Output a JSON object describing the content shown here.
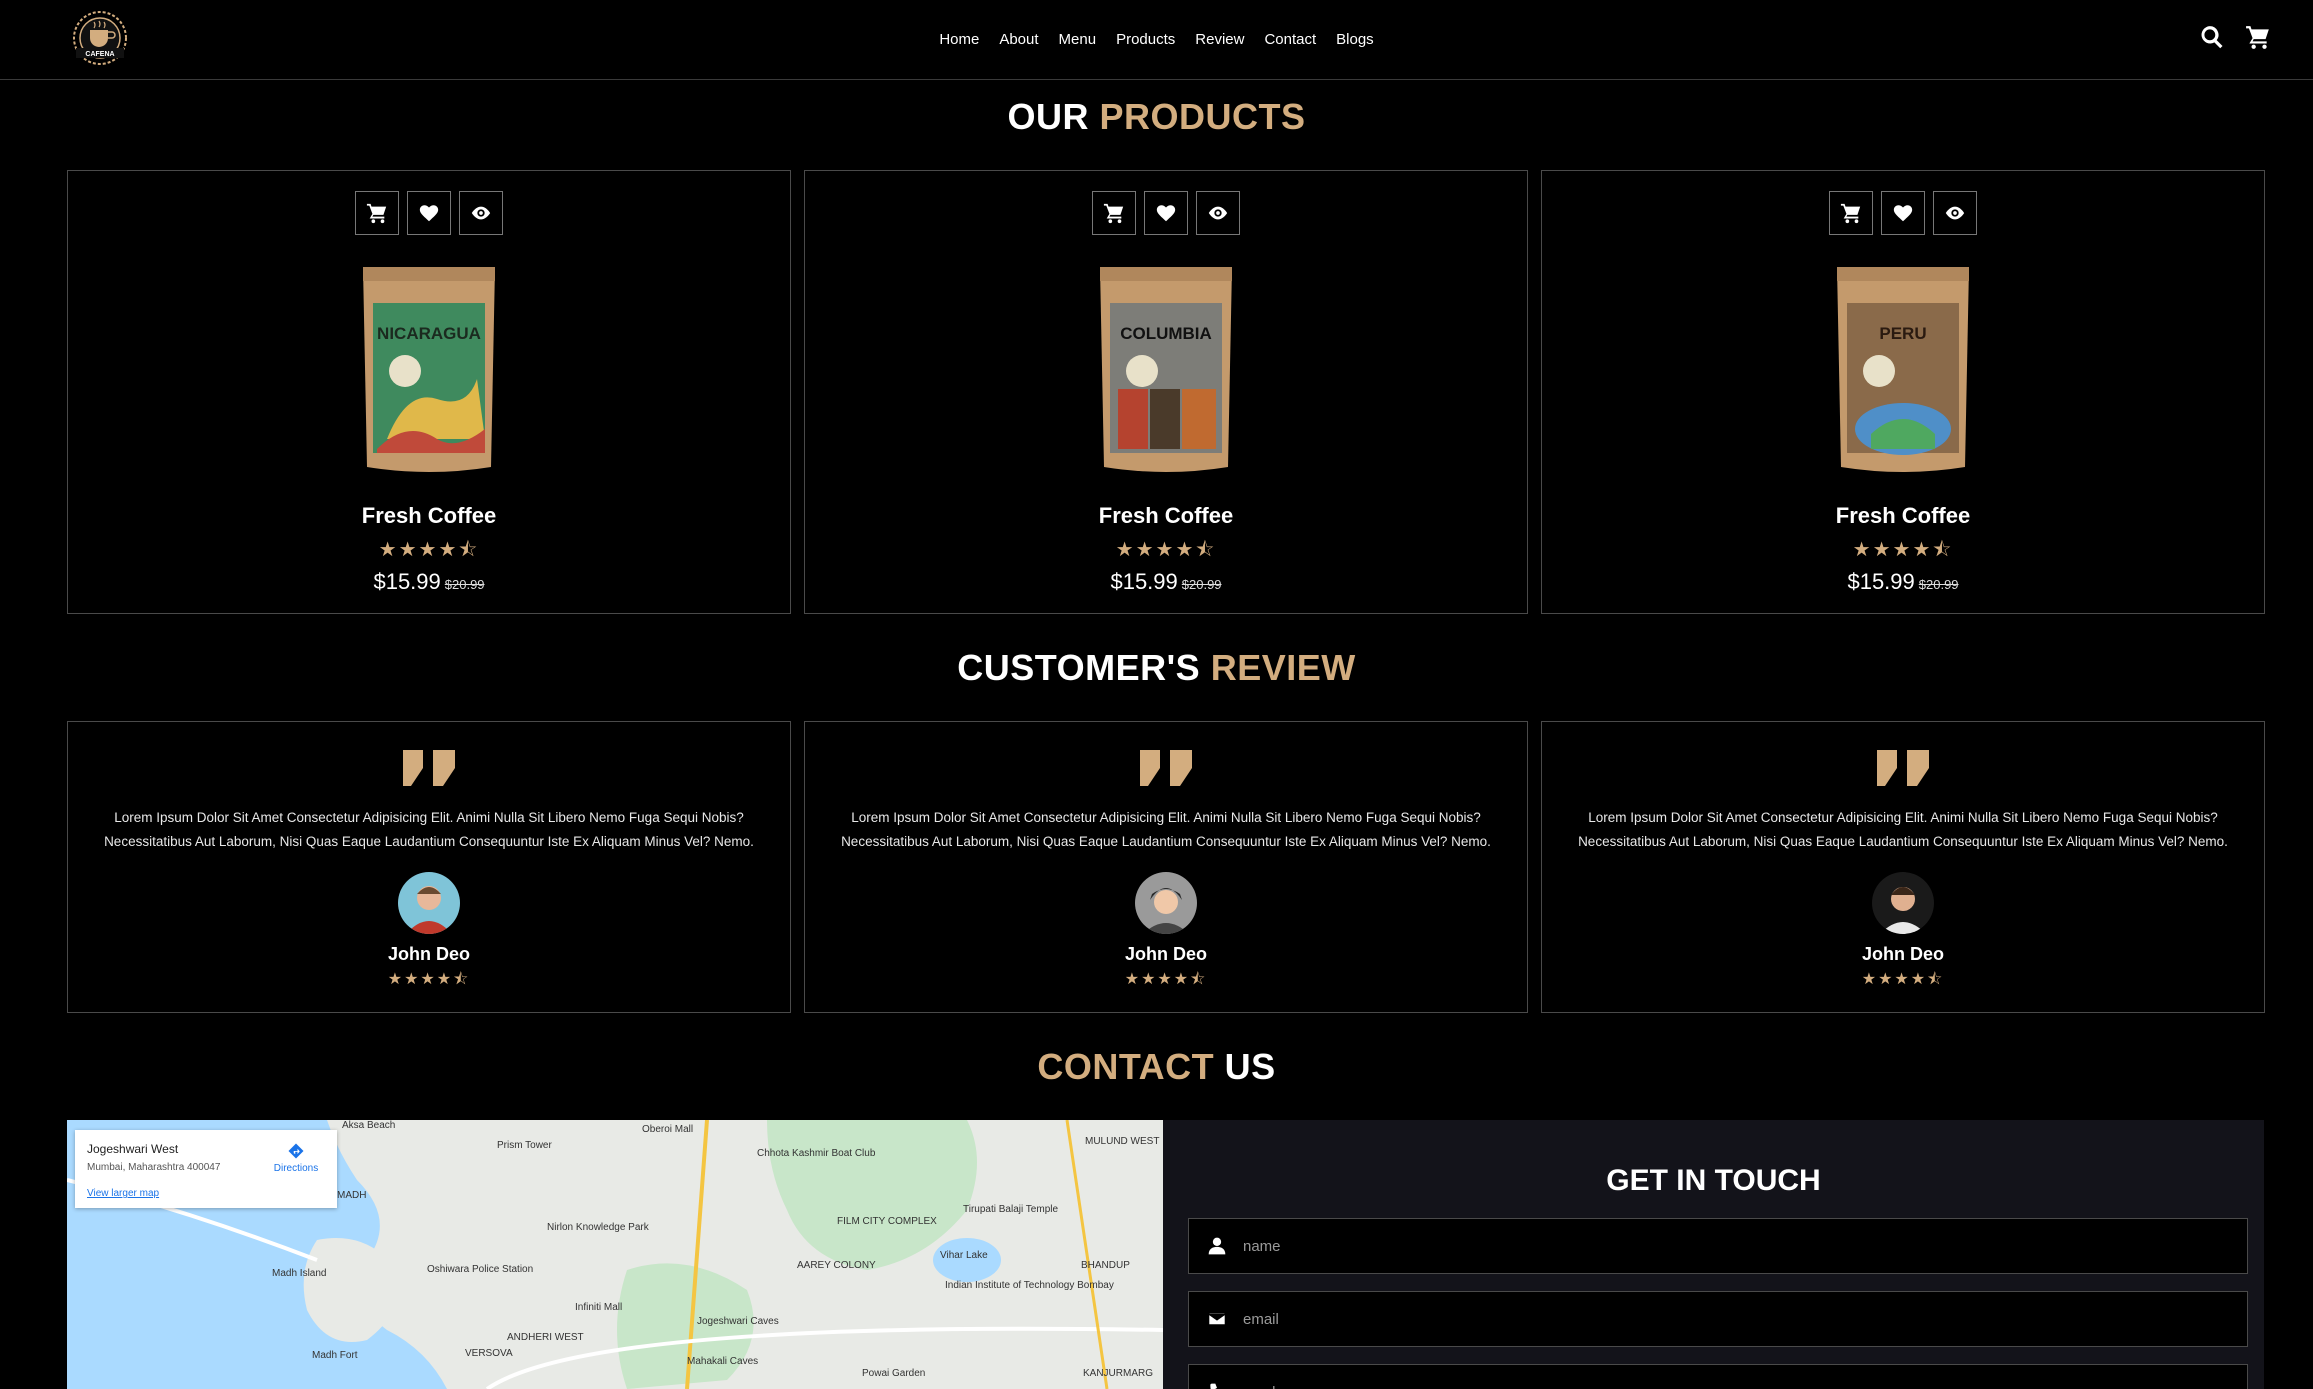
{
  "brand": {
    "logo_text": "CAFENA"
  },
  "nav": {
    "items": [
      "Home",
      "About",
      "Menu",
      "Products",
      "Review",
      "Contact",
      "Blogs"
    ]
  },
  "header_icons": [
    "search-icon",
    "cart-icon"
  ],
  "colors": {
    "accent": "#d3ad7f",
    "background": "#000000",
    "panel": "#13131a",
    "border": "#4a4a4a"
  },
  "products_section": {
    "heading_main": "OUR",
    "heading_accent": "PRODUCTS",
    "items": [
      {
        "name": "Fresh Coffee",
        "price": "$15.99",
        "old_price": "$20.99",
        "rating": 4.5,
        "stars": "★★★★⯪",
        "bag_label": "NICARAGUA",
        "bag_color": "#3f8a5e",
        "action_icons": [
          "cart-icon",
          "heart-icon",
          "eye-icon"
        ]
      },
      {
        "name": "Fresh Coffee",
        "price": "$15.99",
        "old_price": "$20.99",
        "rating": 4.5,
        "stars": "★★★★⯪",
        "bag_label": "COLUMBIA",
        "bag_color": "#7d7d78",
        "action_icons": [
          "cart-icon",
          "heart-icon",
          "eye-icon"
        ]
      },
      {
        "name": "Fresh Coffee",
        "price": "$15.99",
        "old_price": "$20.99",
        "rating": 4.5,
        "stars": "★★★★⯪",
        "bag_label": "PERU",
        "bag_color": "#8a6a4a",
        "action_icons": [
          "cart-icon",
          "heart-icon",
          "eye-icon"
        ]
      }
    ]
  },
  "review_section": {
    "heading_main": "CUSTOMER'S",
    "heading_accent": "REVIEW",
    "items": [
      {
        "text": "Lorem Ipsum Dolor Sit Amet Consectetur Adipisicing Elit. Animi Nulla Sit Libero Nemo Fuga Sequi Nobis? Necessitatibus Aut Laborum, Nisi Quas Eaque Laudantium Consequuntur Iste Ex Aliquam Minus Vel? Nemo.",
        "name": "John Deo",
        "rating": 4.5,
        "stars": "★★★★⯪"
      },
      {
        "text": "Lorem Ipsum Dolor Sit Amet Consectetur Adipisicing Elit. Animi Nulla Sit Libero Nemo Fuga Sequi Nobis? Necessitatibus Aut Laborum, Nisi Quas Eaque Laudantium Consequuntur Iste Ex Aliquam Minus Vel? Nemo.",
        "name": "John Deo",
        "rating": 4.5,
        "stars": "★★★★⯪"
      },
      {
        "text": "Lorem Ipsum Dolor Sit Amet Consectetur Adipisicing Elit. Animi Nulla Sit Libero Nemo Fuga Sequi Nobis? Necessitatibus Aut Laborum, Nisi Quas Eaque Laudantium Consequuntur Iste Ex Aliquam Minus Vel? Nemo.",
        "name": "John Deo",
        "rating": 4.5,
        "stars": "★★★★⯪"
      }
    ]
  },
  "contact_section": {
    "heading_main": "US",
    "heading_accent": "CONTACT",
    "map": {
      "place": "Jogeshwari West",
      "address": "Mumbai, Maharashtra 400047",
      "larger_map_link": "View larger map",
      "directions_label": "Directions",
      "labels": [
        "Aksa Beach",
        "Oberoi Mall",
        "Prism Tower",
        "Chhota Kashmir Boat Club",
        "MULUND WEST",
        "MADH",
        "Nirlon Knowledge Park",
        "FILM CITY COMPLEX",
        "Tirupati Balaji Temple",
        "Madh Island",
        "Oshiwara Police Station",
        "AAREY COLONY",
        "Vihar Lake",
        "Indian Institute of Technology Bombay",
        "BHANDUP",
        "Infiniti Mall",
        "ANDHERI WEST",
        "Jogeshwari Caves",
        "Madh Fort",
        "VERSOVA",
        "Mahakali Caves",
        "Powai Garden",
        "KANJURMARG"
      ]
    },
    "form": {
      "title": "GET IN TOUCH",
      "name_placeholder": "name",
      "email_placeholder": "email",
      "number_placeholder": "number"
    }
  }
}
